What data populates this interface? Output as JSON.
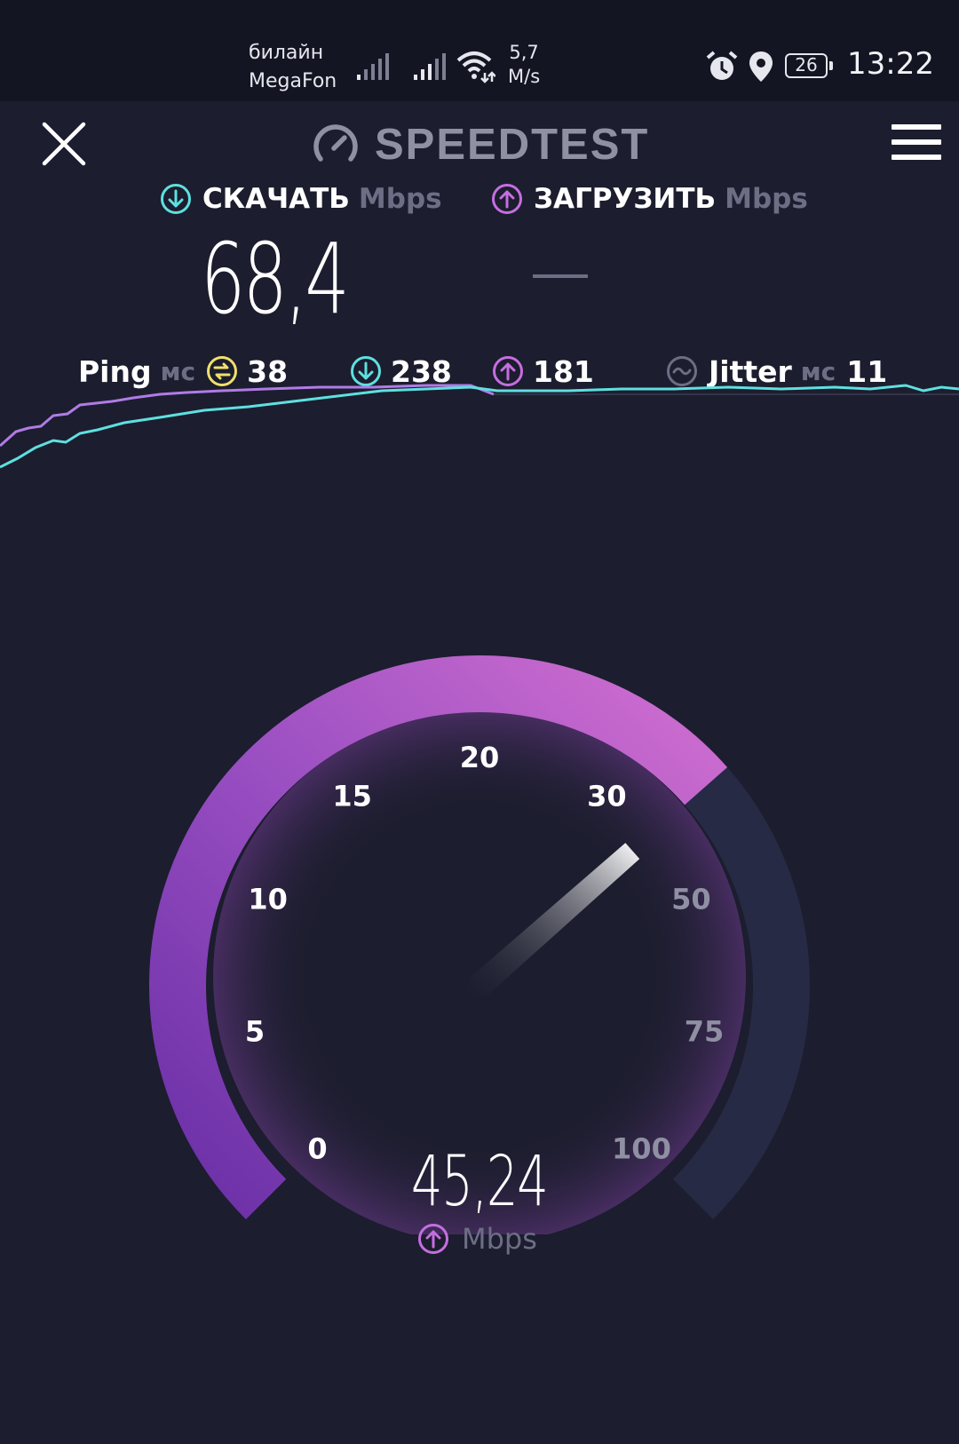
{
  "status_bar": {
    "carrier_1": "билайн",
    "carrier_2": "MegaFon",
    "net_speed_value": "5,7",
    "net_speed_unit": "M/s",
    "battery": "26",
    "time": "13:22",
    "icons": [
      "signal-icon",
      "signal-icon",
      "wifi-icon",
      "alarm-icon",
      "location-icon",
      "battery-icon"
    ]
  },
  "header": {
    "title": "SPEEDTEST",
    "icons": [
      "close-icon",
      "speedometer-icon",
      "menu-icon"
    ]
  },
  "download": {
    "label": "СКАЧАТЬ",
    "unit": "Mbps",
    "value": "68,4",
    "icon": "arrow-down-circle-icon"
  },
  "upload": {
    "label": "ЗАГРУЗИТЬ",
    "unit": "Mbps",
    "value": "—",
    "icon": "arrow-up-circle-icon"
  },
  "stats": {
    "ping_label": "Ping",
    "ping_unit": "мс",
    "ping_value": "38",
    "ping_download": "238",
    "ping_upload": "181",
    "jitter_label": "Jitter",
    "jitter_unit": "мс",
    "jitter_value": "11"
  },
  "gauge": {
    "scale_labels": [
      "0",
      "5",
      "10",
      "15",
      "20",
      "30",
      "50",
      "75",
      "100"
    ],
    "current_value": "45,24",
    "unit": "Mbps",
    "progress_fraction": 0.68
  },
  "colors": {
    "background": "#1c1d2e",
    "status_bar": "#141522",
    "download_accent": "#5ee0e0",
    "upload_accent": "#c56ee0",
    "ping_accent": "#f0e06a",
    "muted": "#6d6e85",
    "gauge_track": "#262a44"
  }
}
